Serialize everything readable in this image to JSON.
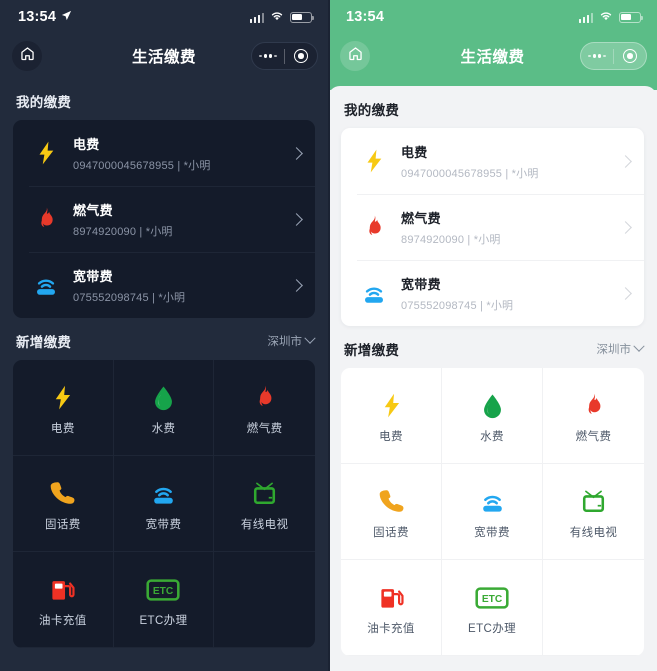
{
  "panels": [
    {
      "theme": "dark",
      "statusbar": {
        "time": "13:54",
        "location_arrow": "➤",
        "signal": "signal-bars",
        "wifi": "wifi",
        "battery": "battery"
      },
      "navbar": {
        "home": "home-icon",
        "title": "生活缴费",
        "more": "more-dots",
        "target": "target-circle"
      },
      "my_bills": {
        "title": "我的缴费",
        "items": [
          {
            "icon": "electricity",
            "name": "电费",
            "sub": "0947000045678955 | *小明"
          },
          {
            "icon": "gas",
            "name": "燃气费",
            "sub": "8974920090 | *小明"
          },
          {
            "icon": "broadband",
            "name": "宽带费",
            "sub": "075552098745 | *小明"
          }
        ]
      },
      "new_bills": {
        "title": "新增缴费",
        "city": "深圳市",
        "items": [
          {
            "icon": "electricity",
            "label": "电费"
          },
          {
            "icon": "water",
            "label": "水费"
          },
          {
            "icon": "gas",
            "label": "燃气费"
          },
          {
            "icon": "phone",
            "label": "固话费"
          },
          {
            "icon": "broadband",
            "label": "宽带费"
          },
          {
            "icon": "tv",
            "label": "有线电视"
          },
          {
            "icon": "fuel",
            "label": "油卡充值"
          },
          {
            "icon": "etc",
            "label": "ETC办理"
          }
        ]
      }
    },
    {
      "theme": "light",
      "statusbar": {
        "time": "13:54",
        "location_arrow": "",
        "signal": "signal-bars",
        "wifi": "wifi",
        "battery": "battery"
      },
      "navbar": {
        "home": "home-icon",
        "title": "生活缴费",
        "more": "more-dots",
        "target": "target-circle"
      },
      "my_bills": {
        "title": "我的缴费",
        "items": [
          {
            "icon": "electricity",
            "name": "电费",
            "sub": "0947000045678955 | *小明"
          },
          {
            "icon": "gas",
            "name": "燃气费",
            "sub": "8974920090 | *小明"
          },
          {
            "icon": "broadband",
            "name": "宽带费",
            "sub": "075552098745 | *小明"
          }
        ]
      },
      "new_bills": {
        "title": "新增缴费",
        "city": "深圳市",
        "items": [
          {
            "icon": "electricity",
            "label": "电费"
          },
          {
            "icon": "water",
            "label": "水费"
          },
          {
            "icon": "gas",
            "label": "燃气费"
          },
          {
            "icon": "phone",
            "label": "固话费"
          },
          {
            "icon": "broadband",
            "label": "宽带费"
          },
          {
            "icon": "tv",
            "label": "有线电视"
          },
          {
            "icon": "fuel",
            "label": "油卡充值"
          },
          {
            "icon": "etc",
            "label": "ETC办理"
          }
        ]
      }
    }
  ],
  "colors": {
    "dark_bg": "#222b3c",
    "dark_card": "#141b2a",
    "light_bg": "#f2f3f5",
    "light_card": "#ffffff",
    "brand_green": "#5bbd87",
    "icon_electricity": "#f7c913",
    "icon_water": "#16a34a",
    "icon_gas": "#e8392a",
    "icon_phone": "#f0a41e",
    "icon_broadband": "#22a7f0",
    "icon_tv": "#2fa82f",
    "icon_fuel": "#ef3124",
    "icon_etc": "#3aaa35"
  }
}
